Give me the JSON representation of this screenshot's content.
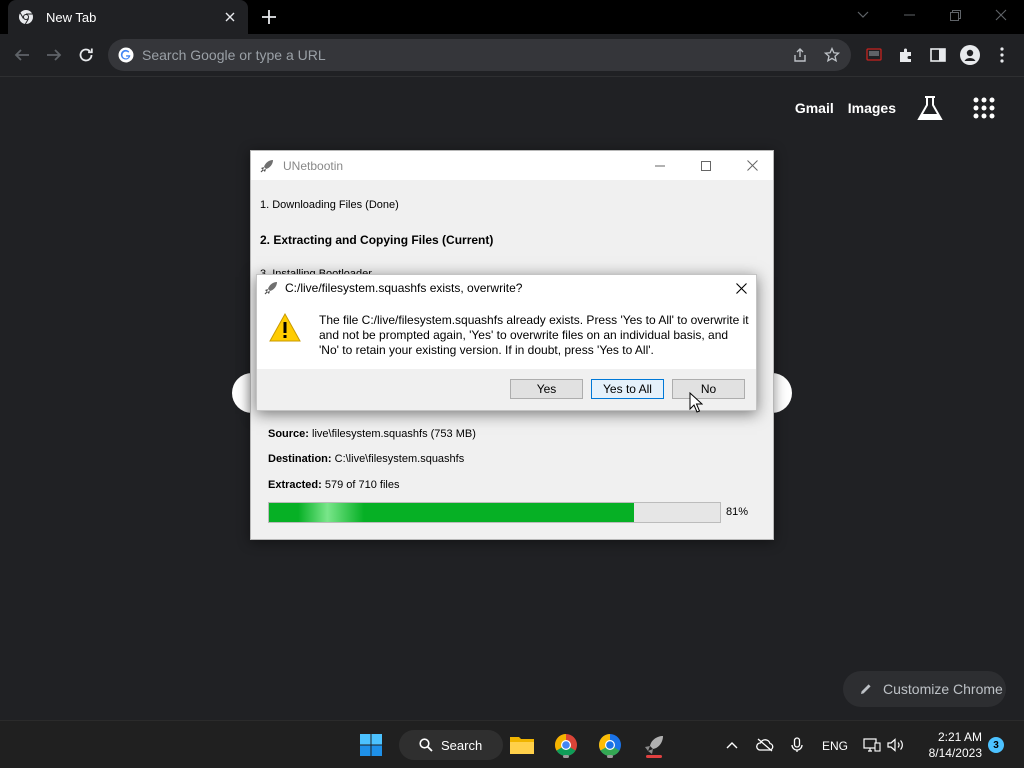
{
  "browser": {
    "tab_title": "New Tab",
    "omnibox_placeholder": "Search Google or type a URL"
  },
  "ntp": {
    "gmail": "Gmail",
    "images": "Images",
    "customize": "Customize Chrome"
  },
  "unetbootin": {
    "title": "UNetbootin",
    "step1": "1. Downloading Files (Done)",
    "step2": "2. Extracting and Copying Files (Current)",
    "step3": "3. Installing Bootloader",
    "source_label": "Source:",
    "source_value": "live\\filesystem.squashfs (753 MB)",
    "destination_label": "Destination:",
    "destination_value": "C:\\live\\filesystem.squashfs",
    "extracted_label": "Extracted:",
    "extracted_value": "579 of 710 files",
    "progress_percent": 81,
    "progress_label": "81%"
  },
  "dialog": {
    "title": "C:/live/filesystem.squashfs exists, overwrite?",
    "message": "The file C:/live/filesystem.squashfs already exists. Press 'Yes to All' to overwrite it and not be prompted again, 'Yes' to overwrite files on an individual basis, and 'No' to retain your existing version. If in doubt, press 'Yes to All'.",
    "yes": "Yes",
    "yes_to_all": "Yes to All",
    "no": "No"
  },
  "taskbar": {
    "search": "Search",
    "language": "ENG",
    "time": "2:21 AM",
    "date": "8/14/2023",
    "notifications": "3"
  }
}
